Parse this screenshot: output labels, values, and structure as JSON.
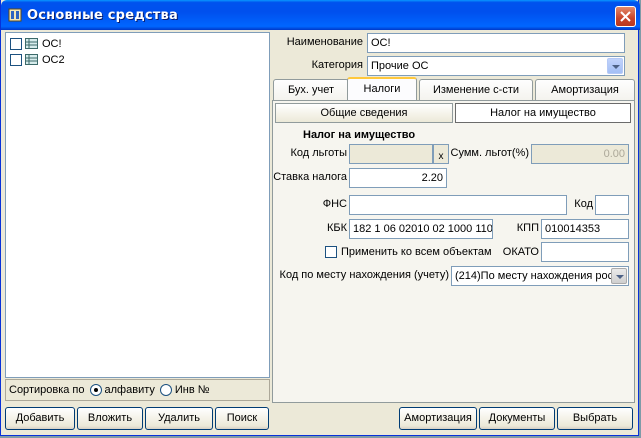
{
  "window": {
    "title": "Основные средства"
  },
  "tree": {
    "items": [
      {
        "label": "ОС!"
      },
      {
        "label": "ОС2"
      }
    ]
  },
  "sort": {
    "label": "Сортировка по",
    "option_alpha": "алфавиту",
    "option_inv": "Инв №",
    "selected": "алфавиту"
  },
  "left_buttons": {
    "add": "Добавить",
    "insert": "Вложить",
    "delete": "Удалить",
    "search": "Поиск"
  },
  "form": {
    "name_label": "Наименование",
    "name_value": "ОС!",
    "category_label": "Категория",
    "category_value": "Прочие ОС"
  },
  "tabs": [
    "Бух. учет",
    "Налоги",
    "Изменение с-сти",
    "Амортизация"
  ],
  "active_tab": "Налоги",
  "subtabs": [
    "Общие сведения",
    "Налог на имущество"
  ],
  "active_subtab": "Налог на имущество",
  "tax": {
    "section_title": "Налог на имущество",
    "benefit_code_label": "Код льготы",
    "benefit_code_value": "",
    "benefit_btn": "x",
    "benefit_sum_label": "Сумм. льгот(%)",
    "benefit_sum_value": "0.00",
    "rate_label": "Ставка налога",
    "rate_value": "2.20",
    "fns_label": "ФНС",
    "fns_value": "",
    "code_label": "Код",
    "code_value": "",
    "kbk_label": "КБК",
    "kbk_value": "182 1 06 02010 02 1000 110",
    "kpp_label": "КПП",
    "kpp_value": "010014353",
    "apply_all_label": "Применить ко всем объектам",
    "okato_label": "ОКАТО",
    "okato_value": "",
    "location_label": "Код по месту нахождения (учету)",
    "location_value": "(214)По месту нахождения рос"
  },
  "bottom_buttons": {
    "amort": "Амортизация",
    "docs": "Документы",
    "choose": "Выбрать"
  }
}
